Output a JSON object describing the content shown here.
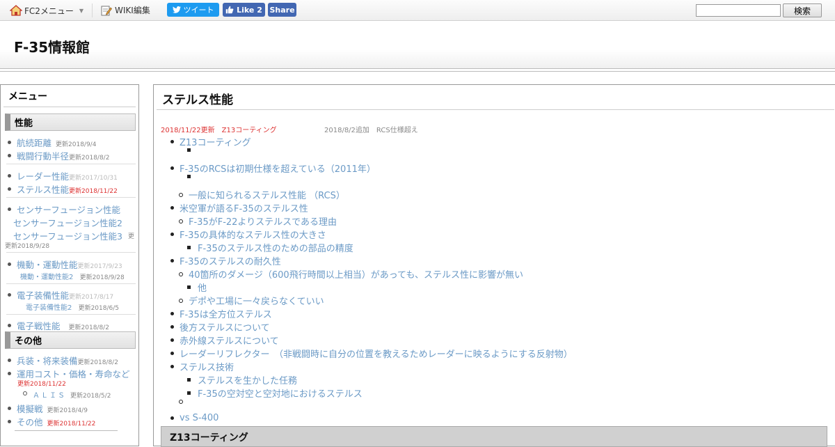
{
  "topbar": {
    "fc2_menu": "FC2メニュー",
    "wiki_edit": "WIKI編集",
    "tweet": "ツイート",
    "like": "Like 2",
    "share": "Share",
    "search_value": "",
    "search_button": "検索"
  },
  "header": {
    "site_title": "F-35情報館"
  },
  "sidebar": {
    "title": "メニュー",
    "categories": [
      "性能",
      "その他"
    ],
    "items": [
      {
        "label": "航続距離",
        "update": "更新2018/9/4"
      },
      {
        "label": "戦闘行動半径",
        "update": "更新2018/8/2"
      },
      {
        "label": "レーダー性能",
        "update": "更新2017/10/31"
      },
      {
        "label": "ステルス性能",
        "update": "更新2018/11/22"
      },
      {
        "label": "センサーフュージョン性能"
      },
      {
        "label": "センサーフュージョン性能2"
      },
      {
        "label": "センサーフュージョン性能3",
        "update": "更新2018/9/28"
      },
      {
        "label": "機動・運動性能",
        "update": "更新2017/9/23"
      },
      {
        "label": "機動・運動性能2",
        "update": "更新2018/9/28"
      },
      {
        "label": "電子装備性能",
        "update": "更新2017/8/17"
      },
      {
        "label": "電子装備性能2",
        "update": "更新2018/6/5"
      },
      {
        "label": "電子戦性能",
        "update": "更新2018/8/2"
      },
      {
        "label": "兵装・将来装備",
        "update": "更新2018/8/2"
      },
      {
        "label": "運用コスト・価格・寿命など",
        "update": "更新2018/11/22"
      },
      {
        "label": "ＡＬＩＳ",
        "update": "更新2018/5/2"
      },
      {
        "label": "模擬戦",
        "update": "更新2018/4/9"
      },
      {
        "label": "その他",
        "update": "更新2018/11/22"
      }
    ]
  },
  "main": {
    "title": "ステルス性能",
    "notice_red": "2018/11/22更新　Z13コーティング",
    "notice_gray": "2018/8/2追加　RCS仕様超え",
    "toc": [
      "Z13コーティング",
      "F-35のRCSは初期仕様を超えている（2011年）",
      "一般に知られるステルス性能 （RCS）",
      "米空軍が語るF-35のステルス性",
      "F-35がF-22よりステルスである理由",
      "F-35の具体的なステルス性の大きさ",
      "F-35のステルス性のための部品の精度",
      "F-35のステルスの耐久性",
      "40箇所のダメージ（600飛行時間以上相当）があっても、ステルス性に影響が無い",
      "他",
      "デポや工場に一々戻らなくていい",
      "F-35は全方位ステルス",
      "後方ステルスについて",
      "赤外線ステルスについて",
      "レーダーリフレクター　（非戦闘時に自分の位置を教えるためレーダーに映るようにする反射物）",
      "ステルス技術",
      "ステルスを生かした任務",
      "F-35の空対空と空対地におけるステルス",
      "vs S-400"
    ],
    "section_heading": "Z13コーティング"
  }
}
